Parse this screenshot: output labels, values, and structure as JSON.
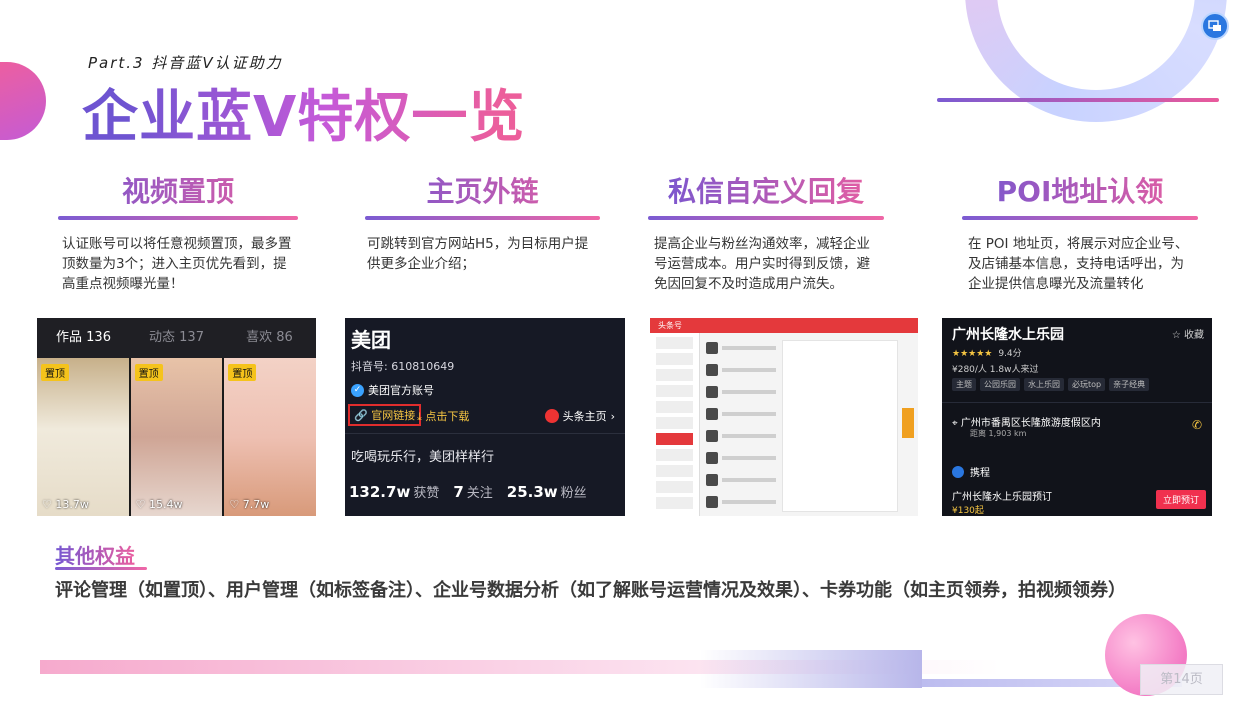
{
  "header": {
    "subtitle": "Part.3  抖音蓝V认证助力",
    "title": "企业蓝V特权一览"
  },
  "features": [
    {
      "title": "视频置顶",
      "desc": "认证账号可以将任意视频置顶，最多置顶数量为3个；进入主页优先看到，提高重点视频曝光量！"
    },
    {
      "title": "主页外链",
      "desc": "可跳转到官方网站H5，为目标用户提供更多企业介绍；"
    },
    {
      "title": "私信自定义回复",
      "desc": "提高企业与粉丝沟通效率，减轻企业号运营成本。用户实时得到反馈，避免因回复不及时造成用户流失。"
    },
    {
      "title": "POI地址认领",
      "desc": "在 POI 地址页，将展示对应企业号、及店铺基本信息，支持电话呼出，为企业提供信息曝光及流量转化"
    }
  ],
  "shot1": {
    "tabs": [
      "作品 136",
      "动态 137",
      "喜欢 86"
    ],
    "pin_label": "置顶",
    "likes": [
      "13.7w",
      "15.4w",
      "7.7w"
    ]
  },
  "shot2": {
    "name": "美团",
    "douyin_id": "抖音号: 610810649",
    "verified": "美团官方账号",
    "official_link": "官网链接",
    "download": "点击下载",
    "toutiao": "头条主页",
    "slogan": "吃喝玩乐行，美团样样行",
    "stat1_value": "132.7w",
    "stat1_label": "获赞",
    "stat2_value": "7",
    "stat2_label": "关注",
    "stat3_value": "25.3w",
    "stat3_label": "粉丝"
  },
  "shot3": {
    "brand": "头条号"
  },
  "shot4": {
    "title": "广州长隆水上乐园",
    "fav": "收藏",
    "rating": "9.4分",
    "price": "¥280/人  1.8w人来过",
    "tags": [
      "主题",
      "公园乐园",
      "水上乐园",
      "必玩top",
      "亲子经典"
    ],
    "address": "广州市番禺区长隆旅游度假区内",
    "distance": "距离 1,903 km",
    "partner": "携程",
    "deal": "广州长隆水上乐园预订",
    "deal_price": "¥130起",
    "book": "立即预订"
  },
  "other": {
    "title": "其他权益",
    "text": "评论管理（如置顶）、用户管理（如标签备注）、企业号数据分析（如了解账号运营情况及效果）、卡券功能（如主页领券，拍视频领券）"
  },
  "footer": {
    "page": "第14页"
  },
  "colors": {
    "accent_purple": "#7356d2",
    "accent_pink": "#ea5e9f"
  },
  "icons": [
    "link-icon",
    "download-icon",
    "verified-icon",
    "phone-icon",
    "heart-icon",
    "location-icon",
    "star-icon",
    "screen-share-icon"
  ]
}
